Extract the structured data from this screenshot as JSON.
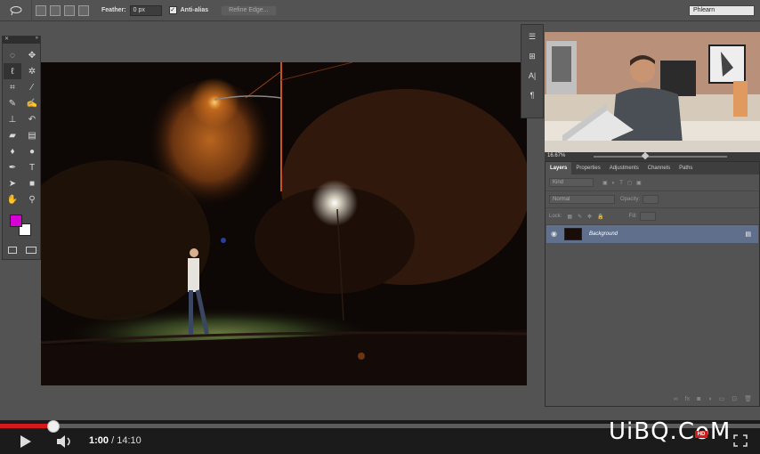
{
  "options_bar": {
    "feather_label": "Feather:",
    "feather_value": "0 px",
    "anti_alias_label": "Anti-alias",
    "refine_edge_label": "Refine Edge...",
    "workspace": "Phlearn"
  },
  "layers_panel": {
    "tabs": [
      "Layers",
      "Properties",
      "Adjustments",
      "Channels",
      "Paths"
    ],
    "filter_kind": "Kind",
    "blend_mode": "Normal",
    "opacity_label": "Opacity:",
    "lock_label": "Lock:",
    "fill_label": "Fill:",
    "layer_name": "Background"
  },
  "video_preview": {
    "zoom": "16.67%"
  },
  "player": {
    "current_time": "1:00",
    "total_time": "/ 14:10",
    "progress": 0.0706,
    "hd_badge": "HD"
  },
  "watermark": "UiBQ.CoM",
  "colors": {
    "foreground": "#d400d4",
    "background": "#ffffff",
    "progress": "#d3191a"
  }
}
